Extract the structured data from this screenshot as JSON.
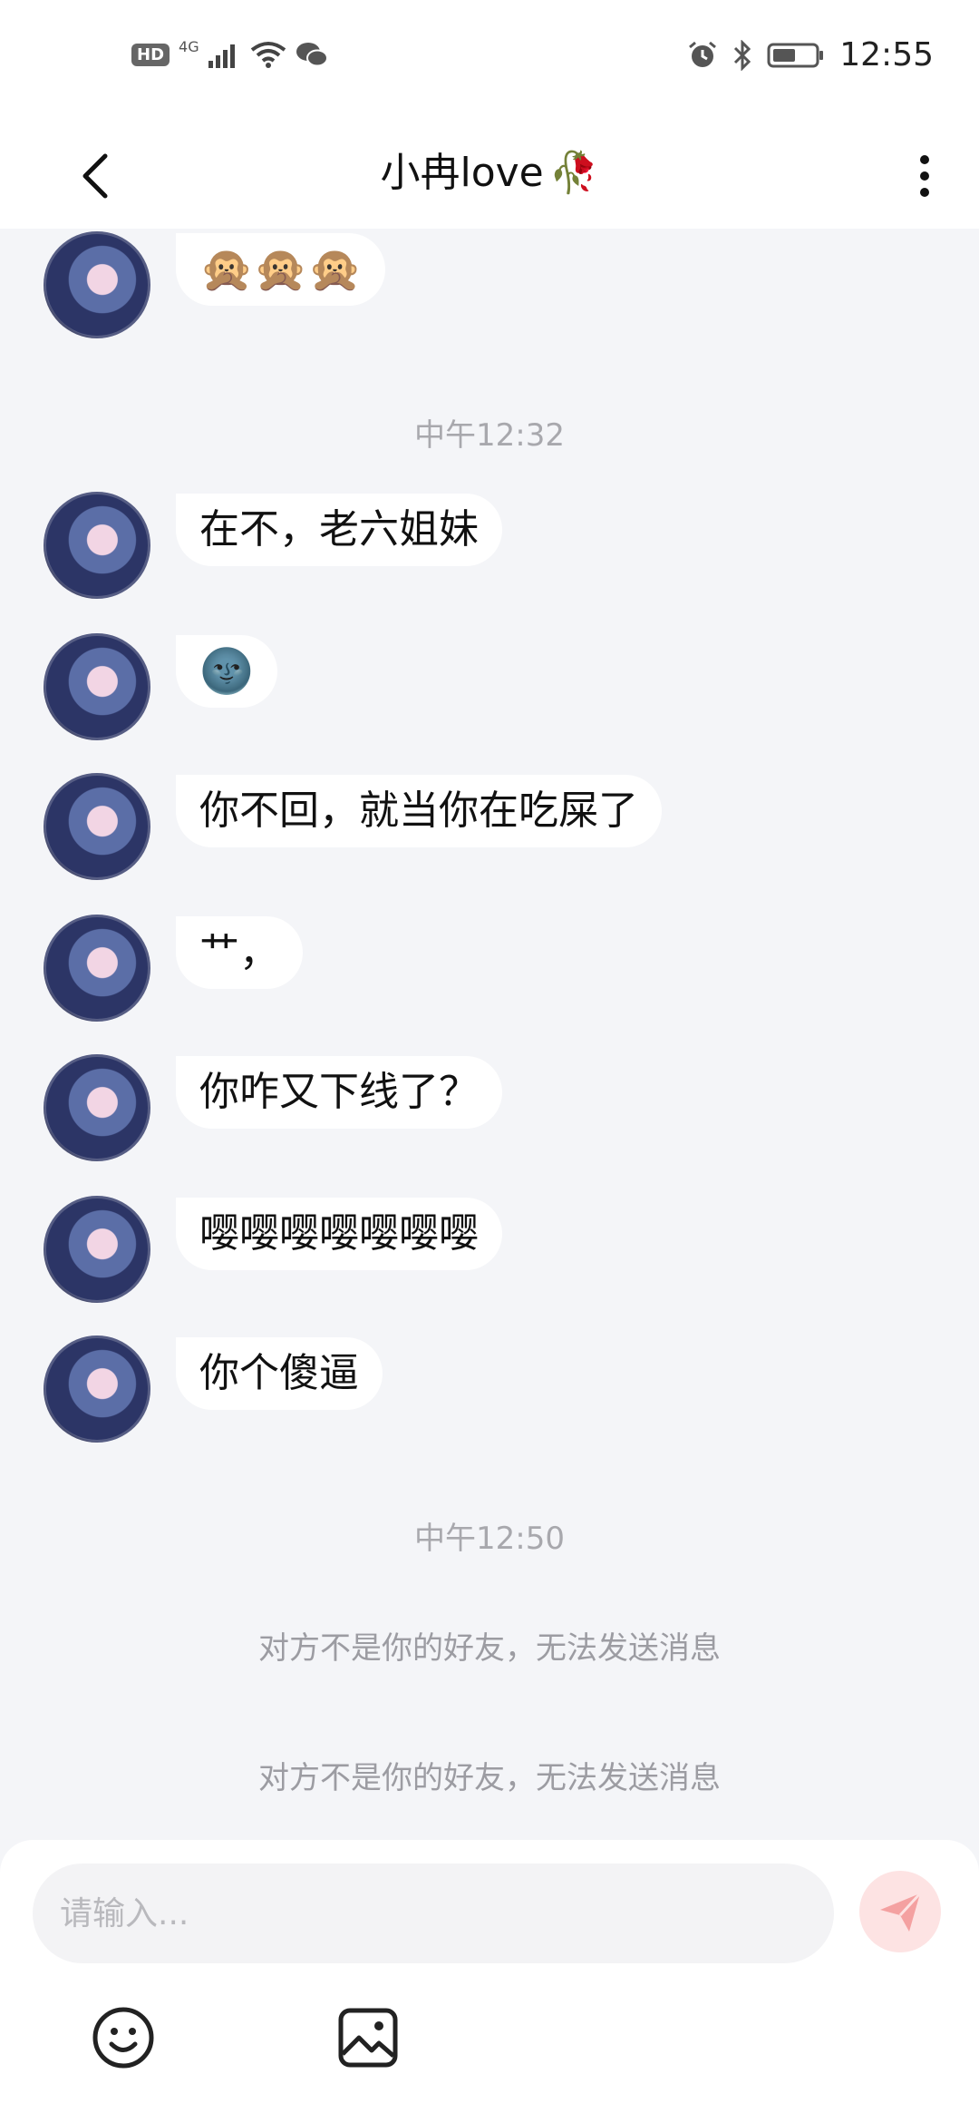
{
  "status_bar": {
    "hd": "HD",
    "network": "4G",
    "time": "12:55"
  },
  "header": {
    "title": "小冉love",
    "title_emoji": "🥀"
  },
  "messages": [
    {
      "text": "🙊🙊🙊",
      "kind": "emoji"
    },
    {
      "timestamp": "中午12:32"
    },
    {
      "text": " 在不，老六姐妹"
    },
    {
      "text": "🌚",
      "kind": "emoji"
    },
    {
      "text": "你不回，就当你在吃屎了"
    },
    {
      "text": "艹，"
    },
    {
      "text": "你咋又下线了？"
    },
    {
      "text": "嘤嘤嘤嘤嘤嘤嘤"
    },
    {
      "text": "你个傻逼"
    },
    {
      "timestamp": "中午12:50"
    }
  ],
  "notices": [
    "对方不是你的好友，无法发送消息",
    "对方不是你的好友，无法发送消息"
  ],
  "input": {
    "placeholder": "请输入..."
  },
  "colors": {
    "background": "#f4f5f8",
    "send_button": "#fde3e3",
    "send_icon": "#f4a1a1"
  }
}
